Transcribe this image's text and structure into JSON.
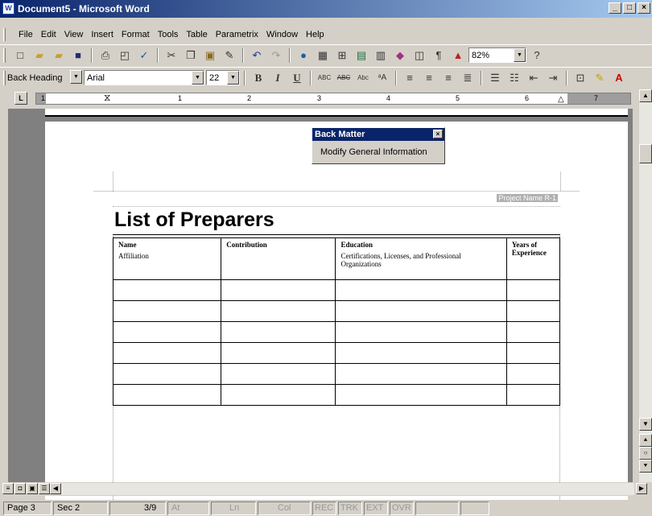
{
  "window": {
    "title": "Document5 - Microsoft Word",
    "app_icon": "W",
    "min": "_",
    "max": "□",
    "close": "×"
  },
  "menubar": [
    "File",
    "Edit",
    "View",
    "Insert",
    "Format",
    "Tools",
    "Table",
    "Parametrix",
    "Window",
    "Help"
  ],
  "standard_toolbar": {
    "zoom": "82%",
    "help": "?"
  },
  "formatting_toolbar": {
    "style": "Back Heading",
    "font": "Arial",
    "size": "22",
    "bold": "B",
    "italic": "I",
    "underline": "U"
  },
  "ruler": {
    "corner": "L",
    "numbers": [
      "1",
      "1",
      "2",
      "3",
      "4",
      "5",
      "6",
      "7"
    ]
  },
  "back_matter_panel": {
    "title": "Back Matter",
    "close": "×",
    "item": "Modify General Information"
  },
  "page_header": {
    "project_name": "Project Name",
    "page_ref": "R-1"
  },
  "document": {
    "title": "List of Preparers",
    "table": {
      "headers": [
        {
          "label": "Name",
          "sub": "Affiliation"
        },
        {
          "label": "Contribution",
          "sub": ""
        },
        {
          "label": "Education",
          "sub": "Certifications, Licenses, and Professional Organizations"
        },
        {
          "label": "Years of Experience",
          "sub": ""
        }
      ],
      "empty_rows": 6
    }
  },
  "statusbar": {
    "page": "Page 3",
    "sec": "Sec 2",
    "pos": "3/9",
    "at": "At",
    "ln": "Ln",
    "col": "Col",
    "rec": "REC",
    "trk": "TRK",
    "ext": "EXT",
    "ovr": "OVR"
  }
}
